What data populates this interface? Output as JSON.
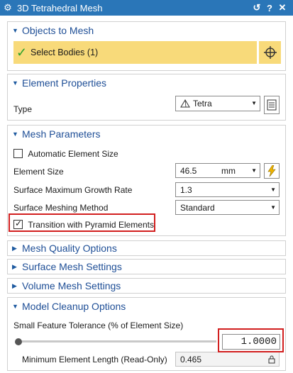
{
  "window": {
    "title": "3D Tetrahedral Mesh",
    "buttons": [
      "↺",
      "?",
      "✕"
    ]
  },
  "objects": {
    "title": "Objects to Mesh",
    "select_label": "Select Bodies (1)"
  },
  "element_properties": {
    "title": "Element Properties",
    "type_label": "Type",
    "type_value": "Tetra"
  },
  "mesh_parameters": {
    "title": "Mesh Parameters",
    "auto_size_label": "Automatic Element Size",
    "auto_size_checked": false,
    "element_size_label": "Element Size",
    "element_size_value": "46.5",
    "element_size_unit": "mm",
    "growth_label": "Surface Maximum Growth Rate",
    "growth_value": "1.3",
    "method_label": "Surface Meshing Method",
    "method_value": "Standard",
    "pyramid_label": "Transition with Pyramid Elements",
    "pyramid_checked": true
  },
  "collapsed_sections": [
    "Mesh Quality Options",
    "Surface Mesh Settings",
    "Volume Mesh Settings"
  ],
  "cleanup": {
    "title": "Model Cleanup Options",
    "tolerance_label": "Small Feature Tolerance (% of Element Size)",
    "tolerance_value": "1.0000",
    "min_length_label": "Minimum Element Length (Read-Only)",
    "min_length_value": "0.465"
  },
  "colors": {
    "title_bar": "#2a76b8",
    "section_title": "#1e4e96",
    "selection_highlight": "#f8da7a",
    "annotation_red": "#d21f1f"
  }
}
